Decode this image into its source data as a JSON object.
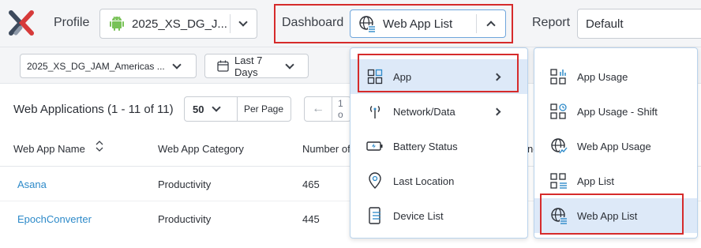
{
  "topbar": {
    "profile_label": "Profile",
    "profile_value": "2025_XS_DG_J...",
    "dashboard_label": "Dashboard",
    "dashboard_value": "Web App List",
    "report_label": "Report",
    "report_value": "Default"
  },
  "filters": {
    "group_value": "2025_XS_DG_JAM_Americas ...",
    "date_value": "Last 7 Days"
  },
  "table": {
    "title": "Web Applications (1 - 11 of 11)",
    "page_size": "50",
    "per_page_label": "Per Page",
    "page_info_partial": "1 o",
    "columns": [
      "Web App Name",
      "Web App Category",
      "Number of"
    ],
    "rows": [
      {
        "name": "Asana",
        "category": "Productivity",
        "number": "465"
      },
      {
        "name": "EpochConverter",
        "category": "Productivity",
        "number": "445"
      }
    ],
    "partial_header_text": "ne"
  },
  "menu": {
    "items": [
      {
        "label": "App",
        "icon": "app-grid-icon",
        "has_submenu": true
      },
      {
        "label": "Network/Data",
        "icon": "antenna-icon",
        "has_submenu": true
      },
      {
        "label": "Battery Status",
        "icon": "battery-icon",
        "has_submenu": false
      },
      {
        "label": "Last Location",
        "icon": "location-pin-icon",
        "has_submenu": false
      },
      {
        "label": "Device List",
        "icon": "device-list-icon",
        "has_submenu": false
      }
    ]
  },
  "submenu": {
    "items": [
      {
        "label": "App Usage",
        "icon": "app-usage-icon"
      },
      {
        "label": "App Usage - Shift",
        "icon": "app-usage-shift-icon"
      },
      {
        "label": "Web App Usage",
        "icon": "web-app-usage-icon"
      },
      {
        "label": "App List",
        "icon": "app-list-icon"
      },
      {
        "label": "Web App List",
        "icon": "web-app-list-icon"
      }
    ]
  },
  "colors": {
    "accent": "#2d8ac9",
    "highlight_border": "#d62b2b",
    "selected_bg": "#dde9f8",
    "logo_dark": "#3d4a5c",
    "logo_red": "#d63a3a",
    "android_green": "#78c257"
  }
}
